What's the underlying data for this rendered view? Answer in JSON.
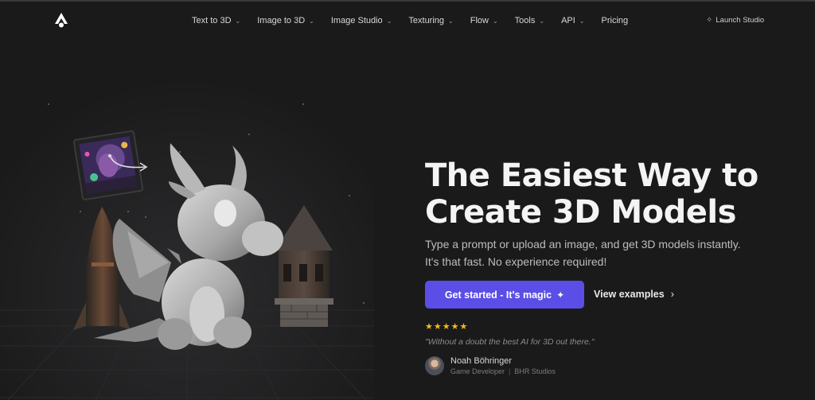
{
  "nav": {
    "items": [
      {
        "label": "Text to 3D",
        "has_dropdown": true
      },
      {
        "label": "Image to 3D",
        "has_dropdown": true
      },
      {
        "label": "Image Studio",
        "has_dropdown": true
      },
      {
        "label": "Texturing",
        "has_dropdown": true
      },
      {
        "label": "Flow",
        "has_dropdown": true
      },
      {
        "label": "Tools",
        "has_dropdown": true
      },
      {
        "label": "API",
        "has_dropdown": true
      },
      {
        "label": "Pricing",
        "has_dropdown": false
      }
    ],
    "launch_label": "Launch Studio",
    "logo_icon": "brand-logo-icon"
  },
  "hero": {
    "headline_line1": "The Easiest Way to",
    "headline_line2": "Create 3D Models",
    "subtitle_line1": "Type a prompt or upload an image, and get 3D models instantly.",
    "subtitle_line2": "It's that fast. No experience required!",
    "cta_label": "Get started - It's magic",
    "secondary_label": "View examples",
    "rating_stars": 5,
    "quote": "\"Without a doubt the best AI for 3D out there.\"",
    "reviewer_name": "Noah Böhringer",
    "reviewer_role": "Game Developer",
    "reviewer_company": "BHR Studios"
  },
  "colors": {
    "background": "#1a1a1b",
    "accent": "#5a4ee6",
    "star": "#f5b91a"
  }
}
